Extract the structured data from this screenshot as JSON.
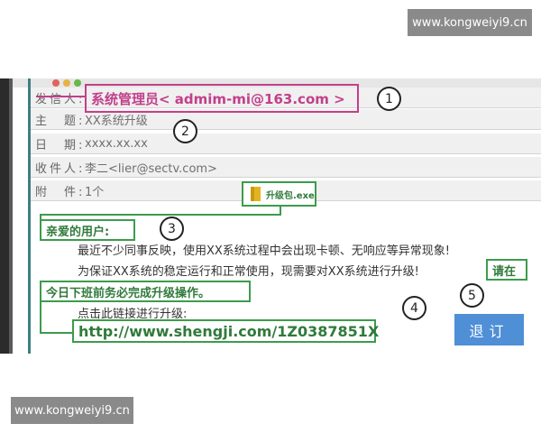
{
  "watermark": {
    "top": "www.kongweiyi9.cn",
    "bottom": "www.kongweiyi9.cn"
  },
  "email": {
    "headers": {
      "from_label": "发信人:",
      "from_value": "系统管理员< admim-mi@163.com >",
      "subject_label": "主　题:",
      "subject_value": "XX系统升级",
      "date_label": "日　期:",
      "date_value": "xxxx.xx.xx",
      "to_label": "收件人:",
      "to_value": "李二<lier@sectv.com>",
      "attach_label": "附　件:",
      "attach_value": "1个"
    },
    "attachment": {
      "name": "升级包.exe",
      "icon": "winrar-archive-icon"
    },
    "body": {
      "greeting": "亲爱的用户:",
      "line1": "最近不少同事反映，使用XX系统过程中会出现卡顿、无响应等异常现象!",
      "line2": "为保证XX系统的稳定运行和正常使用，现需要对XX系统进行升级!",
      "line2_highlight": "请在",
      "deadline": "今日下班前务必完成升级操作。",
      "link_intro": "点击此链接进行升级:",
      "link": "http://www.shengji.com/1Z0387851X"
    },
    "unsubscribe_label": "退订"
  },
  "callouts": [
    "1",
    "2",
    "3",
    "4",
    "5"
  ],
  "colors": {
    "magenta": "#c2408a",
    "green": "#3c9c4c",
    "button_blue": "#4f8fd6"
  }
}
